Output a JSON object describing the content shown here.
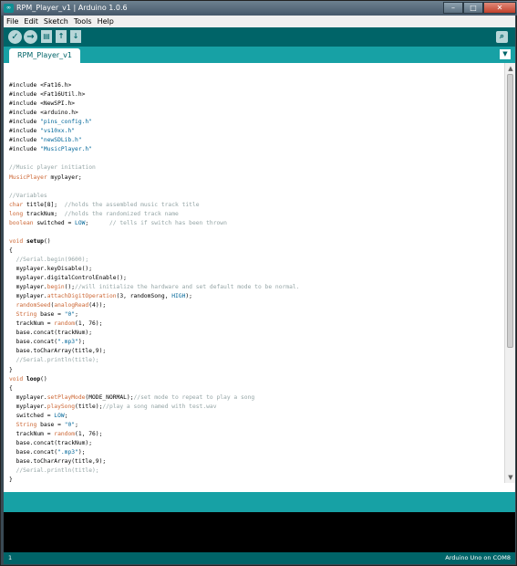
{
  "window": {
    "title": "RPM_Player_v1 | Arduino 1.0.6",
    "icon_label": "∞",
    "minimize_label": "–",
    "maximize_label": "□",
    "close_label": "✕"
  },
  "menu": [
    "File",
    "Edit",
    "Sketch",
    "Tools",
    "Help"
  ],
  "toolbar": {
    "verify_icon": "verify-icon",
    "verify_glyph": "✓",
    "upload_glyph": "→",
    "new_glyph": "▤",
    "open_glyph": "↑",
    "save_glyph": "↓",
    "monitor_glyph": "⌕"
  },
  "tab": {
    "label": "RPM_Player_v1",
    "menu_glyph": "▼"
  },
  "code": [
    {
      "t": ""
    },
    {
      "t": "#include <Fat16.h>"
    },
    {
      "t": "#include <Fat16Util.h>"
    },
    {
      "t": "#include <NewSPI.h>"
    },
    {
      "t": "#include <arduino.h>"
    },
    {
      "t": "#include \"pins_config.h\""
    },
    {
      "t": "#include \"vs10xx.h\""
    },
    {
      "t": "#include \"newSDLib.h\""
    },
    {
      "t": "#include \"MusicPlayer.h\""
    },
    {
      "t": ""
    },
    {
      "t": "//Music player initiation"
    },
    {
      "t": "MusicPlayer myplayer;"
    },
    {
      "t": ""
    },
    {
      "t": "//Variables"
    },
    {
      "t": "char title[8];  //holds the assembled music track title"
    },
    {
      "t": "long trackNum;  //holds the randomized track name"
    },
    {
      "t": "boolean switched = LOW;      // tells if switch has been thrown"
    },
    {
      "t": ""
    },
    {
      "t": "void setup()"
    },
    {
      "t": "{"
    },
    {
      "t": "  //Serial.begin(9600);"
    },
    {
      "t": "  myplayer.keyDisable();"
    },
    {
      "t": "  myplayer.digitalControlEnable();"
    },
    {
      "t": "  myplayer.begin();//will initialize the hardware and set default mode to be normal."
    },
    {
      "t": "  myplayer.attachDigitOperation(3, randomSong, HIGH);"
    },
    {
      "t": "  randomSeed(analogRead(4));"
    },
    {
      "t": "  String base = \"0\";"
    },
    {
      "t": "  trackNum = random(1, 76);"
    },
    {
      "t": "  base.concat(trackNum);"
    },
    {
      "t": "  base.concat(\".mp3\");"
    },
    {
      "t": "  base.toCharArray(title,9);"
    },
    {
      "t": "  //Serial.println(title);"
    },
    {
      "t": "}"
    },
    {
      "t": "void loop()"
    },
    {
      "t": "{"
    },
    {
      "t": "  myplayer.setPlayMode(MODE_NORMAL);//set mode to repeat to play a song"
    },
    {
      "t": "  myplayer.playSong(title);//play a song named with test.wav"
    },
    {
      "t": "  switched = LOW;"
    },
    {
      "t": "  String base = \"0\";"
    },
    {
      "t": "  trackNum = random(1, 76);"
    },
    {
      "t": "  base.concat(trackNum);"
    },
    {
      "t": "  base.concat(\".mp3\");"
    },
    {
      "t": "  base.toCharArray(title,9);"
    },
    {
      "t": "  //Serial.println(title);"
    },
    {
      "t": "}"
    }
  ],
  "status": {
    "line": "1",
    "board": "Arduino Uno on COM8"
  },
  "colors": {
    "teal_dark": "#006468",
    "teal_light": "#17a1a5",
    "keyword": "#cc6633",
    "constant": "#006699",
    "comment": "#95a5a6"
  }
}
